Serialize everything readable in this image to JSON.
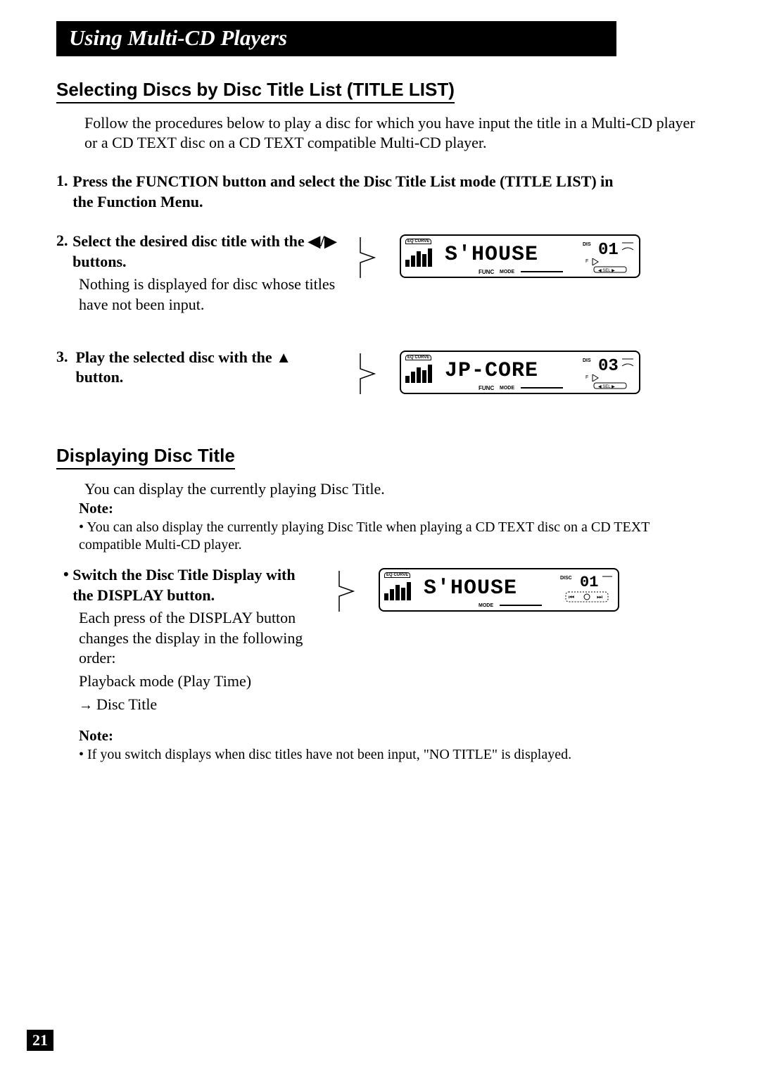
{
  "header": {
    "title": "Using Multi-CD Players"
  },
  "section1": {
    "title": "Selecting Discs by Disc Title List (TITLE LIST)",
    "intro": "Follow the procedures below to play a disc for which you have input the title in a Multi-CD player or a CD TEXT disc on a CD TEXT compatible Multi-CD player.",
    "steps": {
      "1": {
        "num": "1.",
        "title": "Press the FUNCTION button and select the Disc Title List mode (TITLE LIST) in the Function Menu."
      },
      "2": {
        "num": "2.",
        "title_a": "Select the desired disc title with the ",
        "title_b": " buttons.",
        "body": "Nothing is displayed for disc whose titles have not been input.",
        "display": {
          "text": "S'HOUSE",
          "disc": "01",
          "eq": "EQ CURVE",
          "func": "FUNC",
          "mode": "MODE",
          "dis": "DIS",
          "sel": "SEL"
        }
      },
      "3": {
        "num": "3.",
        "title_a": "Play the selected disc with the ",
        "title_b": " button.",
        "display": {
          "text": "JP-CORE",
          "disc": "03",
          "eq": "EQ CURVE",
          "func": "FUNC",
          "mode": "MODE",
          "dis": "DIS",
          "sel": "SEL"
        }
      }
    }
  },
  "section2": {
    "title": "Displaying Disc Title",
    "intro": "You can display the currently playing Disc Title.",
    "note1": {
      "label": "Note:",
      "item": "You can also display the currently playing Disc Title when playing a CD TEXT disc on a CD TEXT compatible Multi-CD player."
    },
    "bullet": {
      "prefix": "•",
      "title": "Switch the Disc Title Display with the DISPLAY button.",
      "body_a": "Each press of the DISPLAY button changes the display in the following order:",
      "body_b": "Playback mode (Play Time)",
      "body_c": "Disc Title",
      "display": {
        "text": "S'HOUSE",
        "disc": "01",
        "disc_label": "DISC",
        "eq": "EQ CURVE",
        "mode": "MODE"
      }
    },
    "note2": {
      "label": "Note:",
      "item": "If you switch displays when disc titles have not been input, \"NO TITLE\" is displayed."
    }
  },
  "page_number": "21"
}
